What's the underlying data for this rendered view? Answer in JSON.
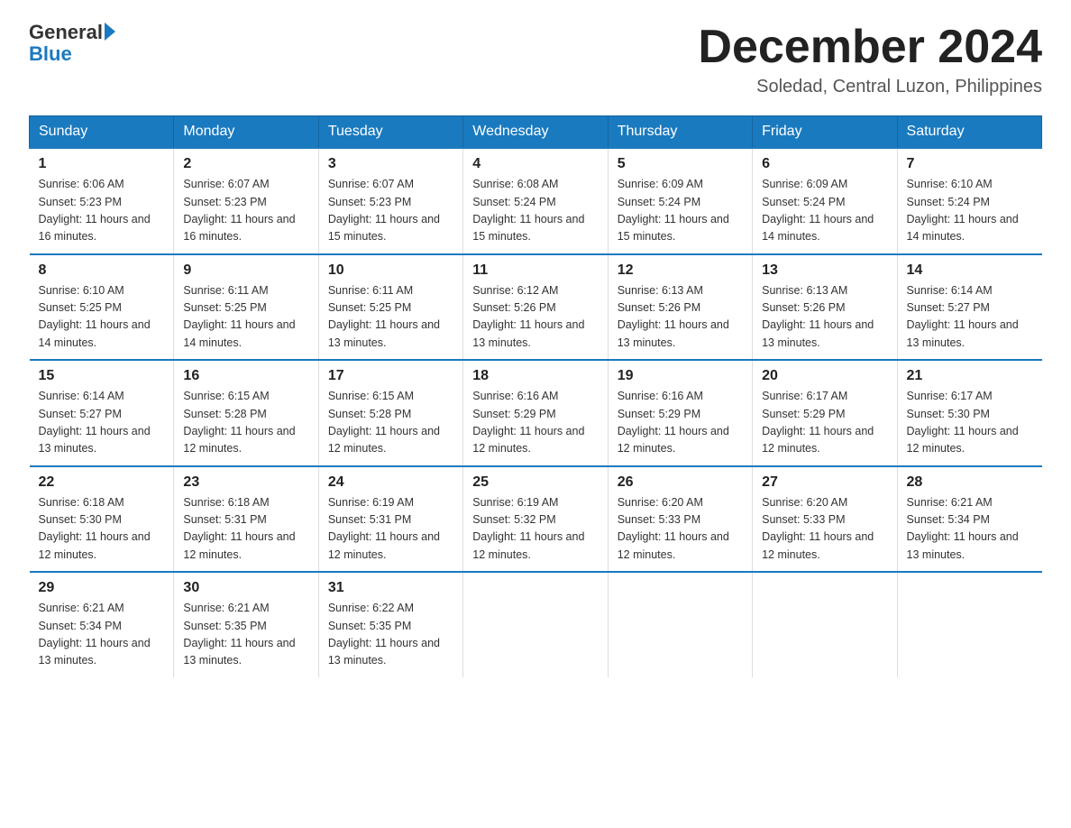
{
  "header": {
    "logo_text_general": "General",
    "logo_text_blue": "Blue",
    "month_title": "December 2024",
    "location": "Soledad, Central Luzon, Philippines"
  },
  "weekdays": [
    "Sunday",
    "Monday",
    "Tuesday",
    "Wednesday",
    "Thursday",
    "Friday",
    "Saturday"
  ],
  "weeks": [
    [
      {
        "day": "1",
        "sunrise": "6:06 AM",
        "sunset": "5:23 PM",
        "daylight": "11 hours and 16 minutes."
      },
      {
        "day": "2",
        "sunrise": "6:07 AM",
        "sunset": "5:23 PM",
        "daylight": "11 hours and 16 minutes."
      },
      {
        "day": "3",
        "sunrise": "6:07 AM",
        "sunset": "5:23 PM",
        "daylight": "11 hours and 15 minutes."
      },
      {
        "day": "4",
        "sunrise": "6:08 AM",
        "sunset": "5:24 PM",
        "daylight": "11 hours and 15 minutes."
      },
      {
        "day": "5",
        "sunrise": "6:09 AM",
        "sunset": "5:24 PM",
        "daylight": "11 hours and 15 minutes."
      },
      {
        "day": "6",
        "sunrise": "6:09 AM",
        "sunset": "5:24 PM",
        "daylight": "11 hours and 14 minutes."
      },
      {
        "day": "7",
        "sunrise": "6:10 AM",
        "sunset": "5:24 PM",
        "daylight": "11 hours and 14 minutes."
      }
    ],
    [
      {
        "day": "8",
        "sunrise": "6:10 AM",
        "sunset": "5:25 PM",
        "daylight": "11 hours and 14 minutes."
      },
      {
        "day": "9",
        "sunrise": "6:11 AM",
        "sunset": "5:25 PM",
        "daylight": "11 hours and 14 minutes."
      },
      {
        "day": "10",
        "sunrise": "6:11 AM",
        "sunset": "5:25 PM",
        "daylight": "11 hours and 13 minutes."
      },
      {
        "day": "11",
        "sunrise": "6:12 AM",
        "sunset": "5:26 PM",
        "daylight": "11 hours and 13 minutes."
      },
      {
        "day": "12",
        "sunrise": "6:13 AM",
        "sunset": "5:26 PM",
        "daylight": "11 hours and 13 minutes."
      },
      {
        "day": "13",
        "sunrise": "6:13 AM",
        "sunset": "5:26 PM",
        "daylight": "11 hours and 13 minutes."
      },
      {
        "day": "14",
        "sunrise": "6:14 AM",
        "sunset": "5:27 PM",
        "daylight": "11 hours and 13 minutes."
      }
    ],
    [
      {
        "day": "15",
        "sunrise": "6:14 AM",
        "sunset": "5:27 PM",
        "daylight": "11 hours and 13 minutes."
      },
      {
        "day": "16",
        "sunrise": "6:15 AM",
        "sunset": "5:28 PM",
        "daylight": "11 hours and 12 minutes."
      },
      {
        "day": "17",
        "sunrise": "6:15 AM",
        "sunset": "5:28 PM",
        "daylight": "11 hours and 12 minutes."
      },
      {
        "day": "18",
        "sunrise": "6:16 AM",
        "sunset": "5:29 PM",
        "daylight": "11 hours and 12 minutes."
      },
      {
        "day": "19",
        "sunrise": "6:16 AM",
        "sunset": "5:29 PM",
        "daylight": "11 hours and 12 minutes."
      },
      {
        "day": "20",
        "sunrise": "6:17 AM",
        "sunset": "5:29 PM",
        "daylight": "11 hours and 12 minutes."
      },
      {
        "day": "21",
        "sunrise": "6:17 AM",
        "sunset": "5:30 PM",
        "daylight": "11 hours and 12 minutes."
      }
    ],
    [
      {
        "day": "22",
        "sunrise": "6:18 AM",
        "sunset": "5:30 PM",
        "daylight": "11 hours and 12 minutes."
      },
      {
        "day": "23",
        "sunrise": "6:18 AM",
        "sunset": "5:31 PM",
        "daylight": "11 hours and 12 minutes."
      },
      {
        "day": "24",
        "sunrise": "6:19 AM",
        "sunset": "5:31 PM",
        "daylight": "11 hours and 12 minutes."
      },
      {
        "day": "25",
        "sunrise": "6:19 AM",
        "sunset": "5:32 PM",
        "daylight": "11 hours and 12 minutes."
      },
      {
        "day": "26",
        "sunrise": "6:20 AM",
        "sunset": "5:33 PM",
        "daylight": "11 hours and 12 minutes."
      },
      {
        "day": "27",
        "sunrise": "6:20 AM",
        "sunset": "5:33 PM",
        "daylight": "11 hours and 12 minutes."
      },
      {
        "day": "28",
        "sunrise": "6:21 AM",
        "sunset": "5:34 PM",
        "daylight": "11 hours and 13 minutes."
      }
    ],
    [
      {
        "day": "29",
        "sunrise": "6:21 AM",
        "sunset": "5:34 PM",
        "daylight": "11 hours and 13 minutes."
      },
      {
        "day": "30",
        "sunrise": "6:21 AM",
        "sunset": "5:35 PM",
        "daylight": "11 hours and 13 minutes."
      },
      {
        "day": "31",
        "sunrise": "6:22 AM",
        "sunset": "5:35 PM",
        "daylight": "11 hours and 13 minutes."
      },
      null,
      null,
      null,
      null
    ]
  ]
}
